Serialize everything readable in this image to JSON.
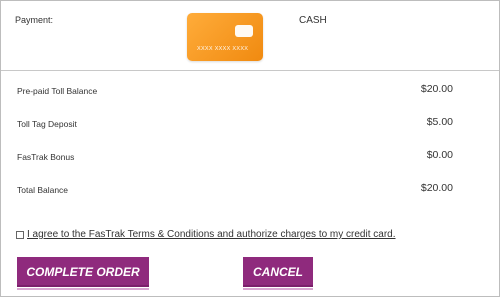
{
  "payment": {
    "label": "Payment:",
    "card_number": "XXXX  XXXX  XXXX",
    "method": "CASH"
  },
  "summary": [
    {
      "label": "Pre-paid Toll Balance",
      "value": "$20.00"
    },
    {
      "label": "Toll Tag Deposit",
      "value": "$5.00"
    },
    {
      "label": "FasTrak Bonus",
      "value": "$0.00"
    },
    {
      "label": "Total Balance",
      "value": "$20.00"
    }
  ],
  "agreement": {
    "text": "I agree to the FasTrak Terms & Conditions and authorize charges to my credit card."
  },
  "actions": {
    "complete_label": "COMPLETE ORDER",
    "cancel_label": "CANCEL"
  },
  "colors": {
    "accent": "#8f2a7d",
    "card_orange": "#f7941d"
  },
  "icons": {
    "card": "credit-card-icon"
  }
}
